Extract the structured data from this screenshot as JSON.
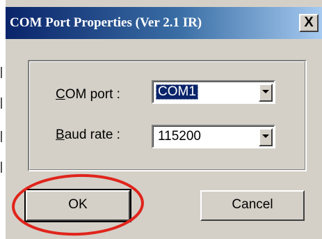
{
  "dialog": {
    "title": "COM Port Properties (Ver 2.1 IR)",
    "close_label": "X"
  },
  "fields": {
    "com_port": {
      "label_mnemonic": "C",
      "label_rest": "OM port :",
      "value": "COM1"
    },
    "baud_rate": {
      "label_mnemonic": "B",
      "label_rest": "aud rate :",
      "value": "115200"
    }
  },
  "buttons": {
    "ok_label": "OK",
    "cancel_label": "Cancel"
  },
  "colors": {
    "title_bar_start": "#0a246a",
    "title_bar_end": "#a6caf0",
    "dialog_face": "#d4d0c8",
    "selection": "#0a246a",
    "highlight_ring": "#e0241b"
  },
  "icons": {
    "close": "close-icon",
    "dropdown": "chevron-down-icon"
  }
}
